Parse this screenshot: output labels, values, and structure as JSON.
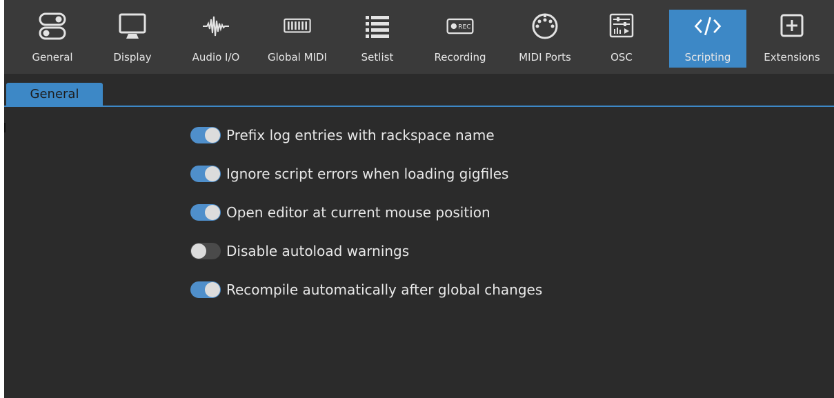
{
  "toolbar": {
    "items": [
      {
        "label": "General",
        "icon": "toggles-icon"
      },
      {
        "label": "Display",
        "icon": "monitor-icon"
      },
      {
        "label": "Audio I/O",
        "icon": "waveform-icon"
      },
      {
        "label": "Global MIDI",
        "icon": "keyboard-icon"
      },
      {
        "label": "Setlist",
        "icon": "list-icon"
      },
      {
        "label": "Recording",
        "icon": "rec-icon",
        "badge": "REC"
      },
      {
        "label": "MIDI Ports",
        "icon": "din-plug-icon"
      },
      {
        "label": "OSC",
        "icon": "osc-icon"
      },
      {
        "label": "Scripting",
        "icon": "code-icon",
        "active": true
      },
      {
        "label": "Extensions",
        "icon": "plus-box-icon"
      }
    ]
  },
  "tabs": [
    {
      "label": "General",
      "active": true
    }
  ],
  "options": [
    {
      "label": "Prefix log entries with rackspace name",
      "enabled": true
    },
    {
      "label": "Ignore script errors when loading gigfiles",
      "enabled": true
    },
    {
      "label": "Open editor at current mouse position",
      "enabled": true
    },
    {
      "label": "Disable autoload warnings",
      "enabled": false
    },
    {
      "label": "Recompile automatically after global changes",
      "enabled": true
    }
  ],
  "colors": {
    "accent": "#3d88c6",
    "toggle_on": "#4f8fcb",
    "toggle_off": "#4a4a4a",
    "toolbar_bg": "#3a3a3a",
    "panel_bg": "#2b2b2b"
  }
}
